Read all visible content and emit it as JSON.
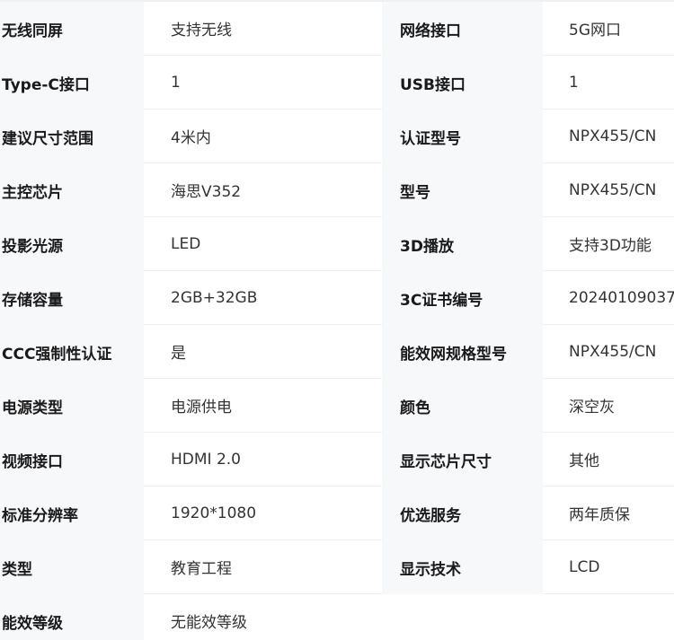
{
  "specs": [
    {
      "label1": "无线同屏",
      "value1": "支持无线",
      "label2": "网络接口",
      "value2": "5G网口"
    },
    {
      "label1": "Type-C接口",
      "value1": "1",
      "label2": "USB接口",
      "value2": "1"
    },
    {
      "label1": "建议尺寸范围",
      "value1": "4米内",
      "label2": "认证型号",
      "value2": "NPX455/CN"
    },
    {
      "label1": "主控芯片",
      "value1": "海思V352",
      "label2": "型号",
      "value2": "NPX455/CN"
    },
    {
      "label1": "投影光源",
      "value1": "LED",
      "label2": "3D播放",
      "value2": "支持3D功能"
    },
    {
      "label1": "存储容量",
      "value1": "2GB+32GB",
      "label2": "3C证书编号",
      "value2": "20240109037"
    },
    {
      "label1": "CCC强制性认证",
      "value1": "是",
      "label2": "能效网规格型号",
      "value2": "NPX455/CN"
    },
    {
      "label1": "电源类型",
      "value1": "电源供电",
      "label2": "颜色",
      "value2": "深空灰"
    },
    {
      "label1": "视频接口",
      "value1": "HDMI 2.0",
      "label2": "显示芯片尺寸",
      "value2": "其他"
    },
    {
      "label1": "标准分辨率",
      "value1": "1920*1080",
      "label2": "优选服务",
      "value2": "两年质保"
    },
    {
      "label1": "类型",
      "value1": "教育工程",
      "label2": "显示技术",
      "value2": "LCD"
    },
    {
      "label1": "能效等级",
      "value1": "无能效等级",
      "label2": "",
      "value2": ""
    }
  ]
}
